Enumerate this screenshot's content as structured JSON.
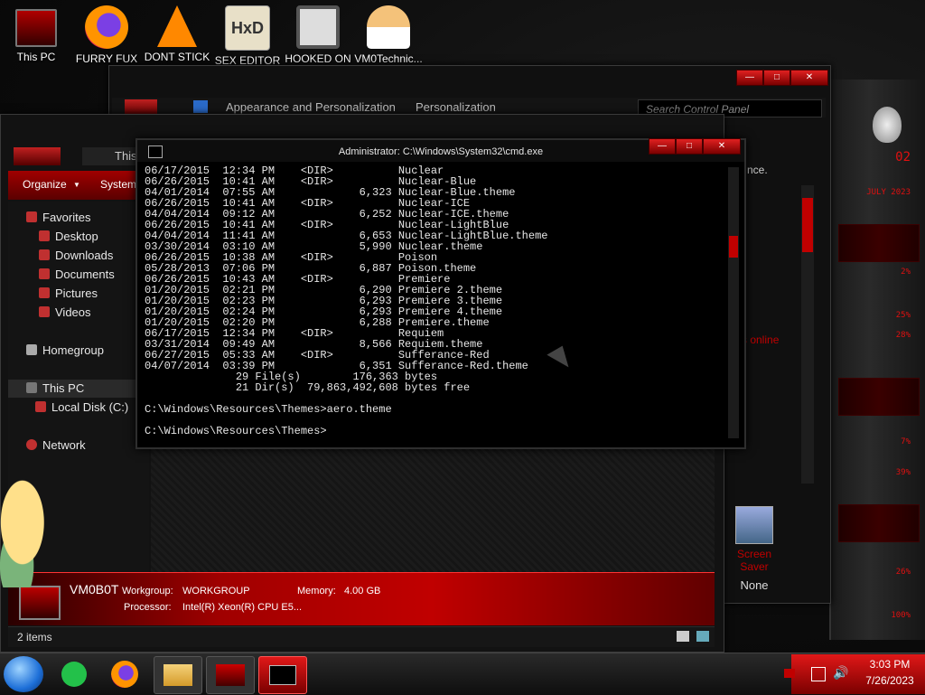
{
  "desktop": {
    "icons": [
      {
        "label": "This PC",
        "icon": "monitor-icon"
      },
      {
        "label": "FURRY FUX",
        "icon": "firefox-icon"
      },
      {
        "label": "DONT STICK",
        "icon": "vlc-icon"
      },
      {
        "label": "SEX EDITOR",
        "icon": "hxd-icon"
      },
      {
        "label": "HOOKED ON",
        "icon": "app-icon"
      },
      {
        "label": "VM0Technic...",
        "icon": "doctor-icon"
      }
    ]
  },
  "control_panel": {
    "breadcrumb": [
      "Appearance and Personalization",
      "Personalization"
    ],
    "search_placeholder": "Search Control Panel",
    "snippet_right": "nce.",
    "snippet_online": "s online",
    "screen_saver_label": "Screen Saver",
    "screen_saver_value": "None"
  },
  "explorer": {
    "tab_title": "This",
    "toolbar": {
      "organize": "Organize",
      "system": "System"
    },
    "nav": {
      "favorites": "Favorites",
      "desktop": "Desktop",
      "downloads": "Downloads",
      "documents": "Documents",
      "pictures": "Pictures",
      "videos": "Videos",
      "homegroup": "Homegroup",
      "this_pc": "This PC",
      "local_disk": "Local Disk (C:)",
      "network": "Network"
    },
    "details": {
      "computer_name": "VM0B0T",
      "workgroup_label": "Workgroup:",
      "workgroup_value": "WORKGROUP",
      "memory_label": "Memory:",
      "memory_value": "4.00 GB",
      "processor_label": "Processor:",
      "processor_value": "Intel(R) Xeon(R) CPU E5..."
    },
    "status": "2 items"
  },
  "cmd": {
    "title": "Administrator: C:\\Windows\\System32\\cmd.exe",
    "lines": [
      "06/17/2015  12:34 PM    <DIR>          Nuclear",
      "06/26/2015  10:41 AM    <DIR>          Nuclear-Blue",
      "04/01/2014  07:55 AM             6,323 Nuclear-Blue.theme",
      "06/26/2015  10:41 AM    <DIR>          Nuclear-ICE",
      "04/04/2014  09:12 AM             6,252 Nuclear-ICE.theme",
      "06/26/2015  10:41 AM    <DIR>          Nuclear-LightBlue",
      "04/04/2014  11:41 AM             6,653 Nuclear-LightBlue.theme",
      "03/30/2014  03:10 AM             5,990 Nuclear.theme",
      "06/26/2015  10:38 AM    <DIR>          Poison",
      "05/28/2013  07:06 PM             6,887 Poison.theme",
      "06/26/2015  10:43 AM    <DIR>          Premiere",
      "01/20/2015  02:21 PM             6,290 Premiere 2.theme",
      "01/20/2015  02:23 PM             6,293 Premiere 3.theme",
      "01/20/2015  02:24 PM             6,293 Premiere 4.theme",
      "01/20/2015  02:20 PM             6,288 Premiere.theme",
      "06/17/2015  12:34 PM    <DIR>          Requiem",
      "03/31/2014  09:49 AM             8,566 Requiem.theme",
      "06/27/2015  05:33 AM    <DIR>          Sufferance-Red",
      "04/07/2014  03:39 PM             6,351 Sufferance-Red.theme",
      "              29 File(s)        176,363 bytes",
      "              21 Dir(s)  79,863,492,608 bytes free",
      "",
      "C:\\Windows\\Resources\\Themes>aero.theme",
      "",
      "C:\\Windows\\Resources\\Themes>"
    ]
  },
  "gadget": {
    "readouts": [
      "02",
      "JULY 2023",
      "2%",
      "25%",
      "28%",
      "7%",
      "39%",
      "26%",
      "100%"
    ]
  },
  "taskbar": {
    "time": "3:03 PM",
    "date": "7/26/2023"
  },
  "colors": {
    "accent": "#c00000",
    "bright_red": "#e01818"
  }
}
